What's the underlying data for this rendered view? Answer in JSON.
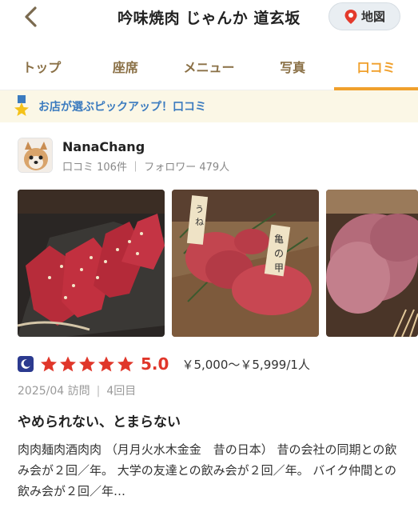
{
  "header": {
    "title": "吟味焼肉 じゃんか 道玄坂",
    "map_label": "地図"
  },
  "tabs": [
    {
      "label": "トップ"
    },
    {
      "label": "座席"
    },
    {
      "label": "メニュー"
    },
    {
      "label": "写真"
    },
    {
      "label": "口コミ"
    }
  ],
  "active_tab": "口コミ",
  "pickup": {
    "label": "お店が選ぶピックアップ！口コミ"
  },
  "review": {
    "reviewer_name": "NanaChang",
    "reviewer_meta": "口コミ 106件 ｜ フォロワー 479人",
    "stars": 5,
    "score": "5.0",
    "price": "￥5,000～￥5,999/1人",
    "visit_date": "2025/04 訪問",
    "visit_count": "4回目",
    "title": "やめられない、とまらない",
    "body": "肉肉麺肉酒肉肉 （月月火水木金金　昔の日本） 昔の会社の同期との飲み会が２回／年。 大学の友達との飲み会が２回／年。 バイク仲間との飲み会が２回／年…"
  },
  "colors": {
    "accent": "#f0a02c",
    "tab_text": "#8a7046",
    "pickup_text": "#3b7bbf",
    "score": "#e0362a"
  }
}
